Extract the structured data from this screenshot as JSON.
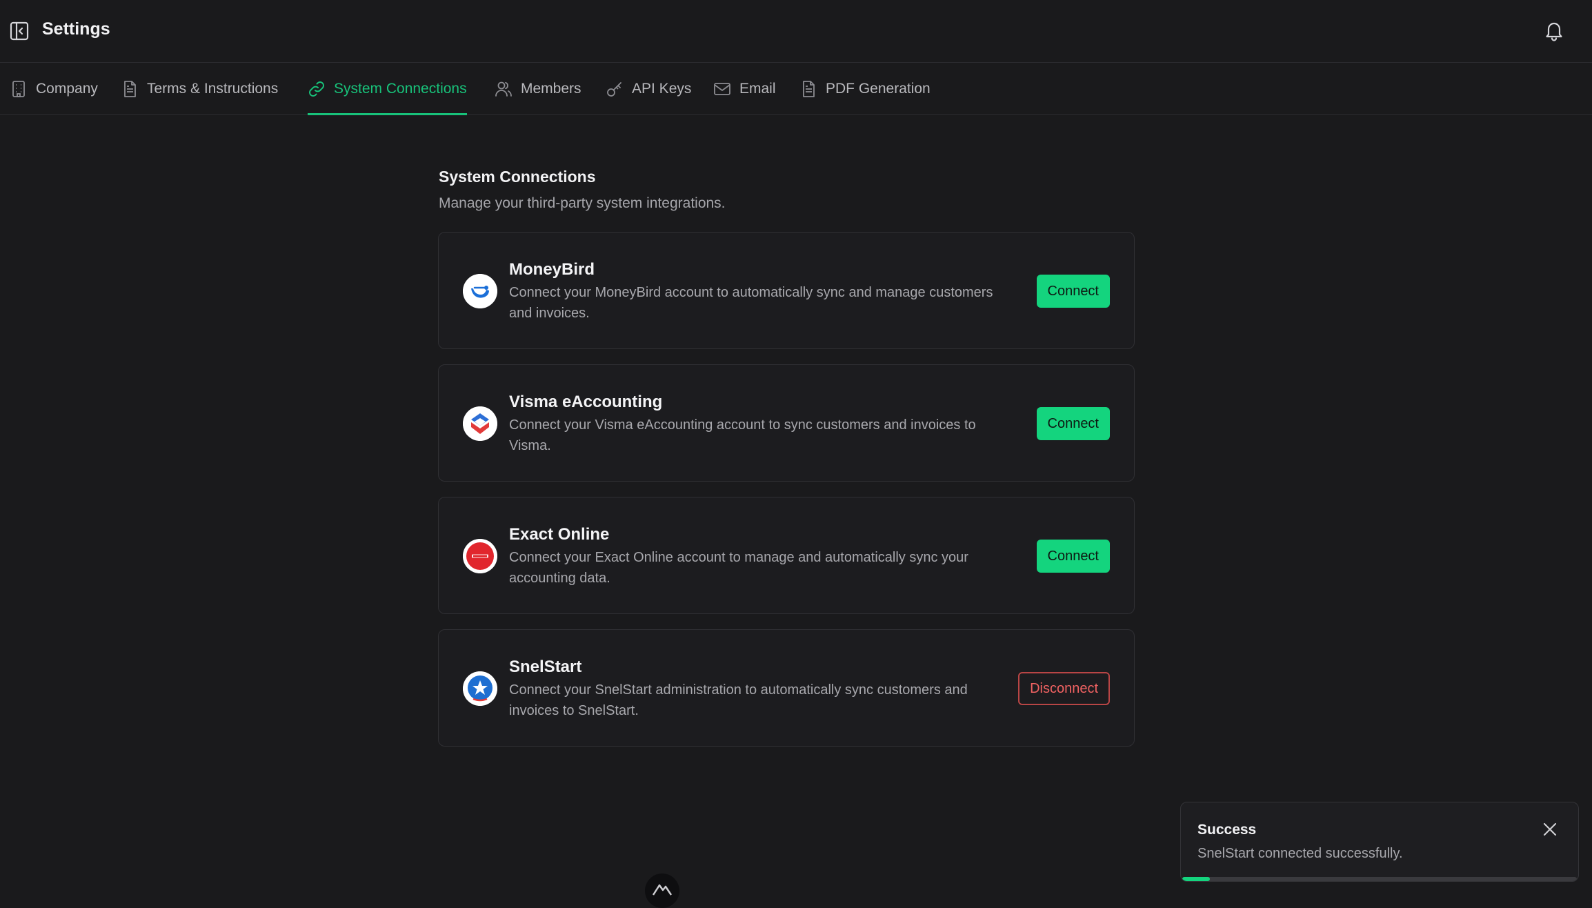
{
  "header": {
    "title": "Settings"
  },
  "tabs": [
    {
      "label": "Company",
      "icon": "building-icon",
      "active": false
    },
    {
      "label": "Terms & Instructions",
      "icon": "document-icon",
      "active": false
    },
    {
      "label": "System Connections",
      "icon": "link-icon",
      "active": true
    },
    {
      "label": "Members",
      "icon": "users-icon",
      "active": false
    },
    {
      "label": "API Keys",
      "icon": "key-icon",
      "active": false
    },
    {
      "label": "Email",
      "icon": "mail-icon",
      "active": false
    },
    {
      "label": "PDF Generation",
      "icon": "file-text-icon",
      "active": false
    }
  ],
  "section": {
    "title": "System Connections",
    "subtitle": "Manage your third-party system integrations."
  },
  "connections": [
    {
      "name": "MoneyBird",
      "description": "Connect your MoneyBird account to automatically sync and manage customers and invoices.",
      "action": "Connect",
      "logo": "moneybird-logo"
    },
    {
      "name": "Visma eAccounting",
      "description": "Connect your Visma eAccounting account to sync customers and invoices to Visma.",
      "action": "Connect",
      "logo": "visma-logo"
    },
    {
      "name": "Exact Online",
      "description": "Connect your Exact Online account to manage and automatically sync your accounting data.",
      "action": "Connect",
      "logo": "exact-logo"
    },
    {
      "name": "SnelStart",
      "description": "Connect your SnelStart administration to automatically sync customers and invoices to SnelStart.",
      "action": "Disconnect",
      "logo": "snelstart-logo"
    }
  ],
  "toast": {
    "title": "Success",
    "message": "SnelStart connected successfully.",
    "progress": 0.07
  },
  "colors": {
    "accent": "#14d47e",
    "danger": "#f06262",
    "background": "#1a1a1c"
  }
}
